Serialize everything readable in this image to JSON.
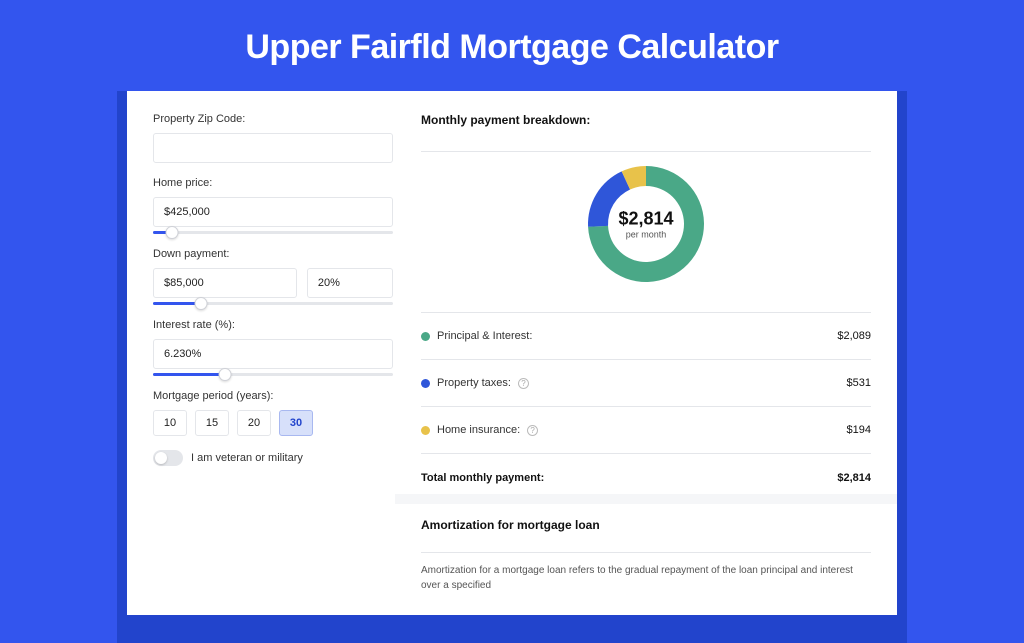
{
  "title": "Upper Fairfld Mortgage Calculator",
  "form": {
    "zip_label": "Property Zip Code:",
    "zip_value": "",
    "home_price_label": "Home price:",
    "home_price_value": "$425,000",
    "home_price_slider_pct": 8,
    "down_payment_label": "Down payment:",
    "down_payment_value": "$85,000",
    "down_payment_pct_value": "20%",
    "down_payment_slider_pct": 20,
    "interest_label": "Interest rate (%):",
    "interest_value": "6.230%",
    "interest_slider_pct": 30,
    "period_label": "Mortgage period (years):",
    "period_options": [
      "10",
      "15",
      "20",
      "30"
    ],
    "period_selected": "30",
    "veteran_label": "I am veteran or military",
    "veteran_on": false
  },
  "breakdown": {
    "title": "Monthly payment breakdown:",
    "center_amount": "$2,814",
    "center_sub": "per month",
    "items": [
      {
        "label": "Principal & Interest:",
        "value": "$2,089",
        "color": "#4aa887",
        "help": false
      },
      {
        "label": "Property taxes:",
        "value": "$531",
        "color": "#2f56d9",
        "help": true
      },
      {
        "label": "Home insurance:",
        "value": "$194",
        "color": "#e8c24a",
        "help": true
      }
    ],
    "total_label": "Total monthly payment:",
    "total_value": "$2,814"
  },
  "amortization": {
    "title": "Amortization for mortgage loan",
    "text": "Amortization for a mortgage loan refers to the gradual repayment of the loan principal and interest over a specified"
  },
  "chart_data": {
    "type": "pie",
    "title": "Monthly payment breakdown",
    "series": [
      {
        "name": "Principal & Interest",
        "value": 2089,
        "color": "#4aa887"
      },
      {
        "name": "Property taxes",
        "value": 531,
        "color": "#2f56d9"
      },
      {
        "name": "Home insurance",
        "value": 194,
        "color": "#e8c24a"
      }
    ],
    "total": 2814,
    "center_label": "$2,814 per month"
  }
}
